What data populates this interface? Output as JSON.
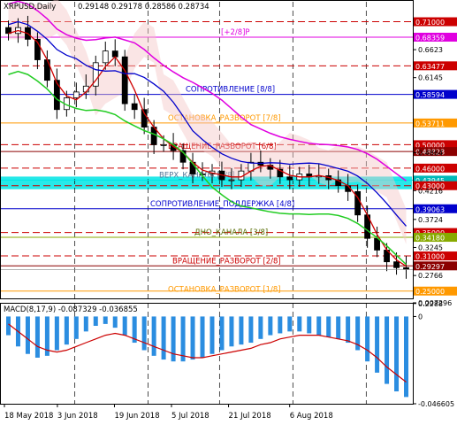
{
  "chart_data": [
    {
      "type": "candlestick",
      "title": "XRPUSD,Daily",
      "ohlc_label": "0.29148 0.29178 0.28586 0.28734",
      "ylim": [
        0.236,
        0.735
      ],
      "y_ticks": [
        0.6623,
        0.6145,
        0.4864,
        0.4216,
        0.3724,
        0.3245,
        0.2766,
        0.2288
      ],
      "x_labels": [
        "18 May 2018",
        "3 Jun 2018",
        "19 Jun 2018",
        "5 Jul 2018",
        "21 Jul 2018",
        "6 Aug 2018"
      ],
      "series": [
        {
          "values": [
            0.69,
            0.7,
            0.68,
            0.645,
            0.61,
            0.56,
            0.58,
            0.59,
            0.6,
            0.64,
            0.66,
            0.65,
            0.57,
            0.56,
            0.53,
            0.5,
            0.5,
            0.49,
            0.47,
            0.45,
            0.45,
            0.455,
            0.44,
            0.44,
            0.455,
            0.47,
            0.465,
            0.458,
            0.445,
            0.44,
            0.45,
            0.445,
            0.447,
            0.44,
            0.43,
            0.42,
            0.38,
            0.34,
            0.32,
            0.3,
            0.29,
            0.287
          ]
        }
      ],
      "levels": [
        {
          "label": "",
          "value": 0.71,
          "price": "0.71000"
        },
        {
          "label": "[+2/8]P",
          "value": 0.6836,
          "price": "0.68359"
        },
        {
          "label": "",
          "value": 0.6347,
          "price": "0.63477"
        },
        {
          "label": "",
          "value": 0.5859,
          "price": "0.58594"
        },
        {
          "label": "СОПРОТИВЛЕНИЕ [8/8]",
          "value": 0.5859,
          "price": ""
        },
        {
          "label": "ОСТАНОВКА_РАЗВОРОТ [7/8]",
          "value": 0.5371,
          "price": "0.53711"
        },
        {
          "label": "",
          "value": 0.5,
          "price": "0.50000"
        },
        {
          "label": "",
          "value": 0.4883,
          "price": "0.48828"
        },
        {
          "label": "ВРАЩЕНИЕ_РАЗВОРОТ [6/8]",
          "value": 0.4883,
          "price": ""
        },
        {
          "label": "",
          "value": 0.46,
          "price": "0.46000"
        },
        {
          "label": "",
          "value": 0.4395,
          "price": "0.43945"
        },
        {
          "label": "ВЕРХ_КАНАЛА [5/8]",
          "value": 0.4395,
          "price": ""
        },
        {
          "label": "",
          "value": 0.43,
          "price": "0.43000"
        },
        {
          "label": "",
          "value": 0.3906,
          "price": "0.39063"
        },
        {
          "label": "СОПРОТИВЛЕНИЕ_ПОДДЕРЖКА [4/8]",
          "value": 0.3906,
          "price": ""
        },
        {
          "label": "",
          "value": 0.35,
          "price": "0.35000"
        },
        {
          "label": "",
          "value": 0.3418,
          "price": "0.34180"
        },
        {
          "label": "ДНО_КАНАЛА [3/8]",
          "value": 0.3418,
          "price": ""
        },
        {
          "label": "",
          "value": 0.31,
          "price": "0.31000"
        },
        {
          "label": "",
          "value": 0.293,
          "price": "0.29297"
        },
        {
          "label": "ВРАЩЕНИЕ_РАЗВОРОТ [2/8]",
          "value": 0.293,
          "price": ""
        },
        {
          "label": "",
          "value": 0.25,
          "price": "0.25000"
        },
        {
          "label": "ОСТАНОВКА_РАЗВОРОТ [1/8]",
          "value": 0.2441,
          "price": ""
        }
      ],
      "current_price": "0.28734",
      "colors": {
        "bull": "#000000",
        "bear": "#000000",
        "ema_red": "#d00000",
        "ma_blue": "#0000cc",
        "green": "#22cc22",
        "magenta": "#e000e0",
        "cyan_zone": "#00e5e5",
        "orange": "#ff9900",
        "dark_red": "#8b0000"
      }
    },
    {
      "type": "histogram",
      "title": "MACD(8,17,9) -0.087329 -0.036855",
      "ylim": [
        -0.046605,
        0.007296
      ],
      "y_ticks": [
        0.007296,
        0.0,
        -0.046605
      ],
      "x_labels": [
        "18 May 2018",
        "3 Jun 2018",
        "19 Jun 2018",
        "5 Jul 2018",
        "21 Jul 2018",
        "6 Aug 2018"
      ],
      "series": [
        {
          "values": [
            -0.01,
            -0.016,
            -0.02,
            -0.022,
            -0.021,
            -0.018,
            -0.015,
            -0.012,
            -0.008,
            -0.005,
            -0.004,
            -0.006,
            -0.01,
            -0.014,
            -0.018,
            -0.021,
            -0.023,
            -0.024,
            -0.024,
            -0.023,
            -0.022,
            -0.02,
            -0.018,
            -0.016,
            -0.015,
            -0.014,
            -0.012,
            -0.01,
            -0.009,
            -0.008,
            -0.008,
            -0.009,
            -0.01,
            -0.011,
            -0.012,
            -0.014,
            -0.018,
            -0.024,
            -0.03,
            -0.036,
            -0.04,
            -0.043
          ]
        },
        {
          "values": [
            -0.004,
            -0.008,
            -0.012,
            -0.016,
            -0.018,
            -0.019,
            -0.018,
            -0.016,
            -0.014,
            -0.012,
            -0.01,
            -0.009,
            -0.01,
            -0.012,
            -0.014,
            -0.016,
            -0.018,
            -0.02,
            -0.021,
            -0.022,
            -0.022,
            -0.021,
            -0.02,
            -0.019,
            -0.018,
            -0.017,
            -0.015,
            -0.014,
            -0.012,
            -0.011,
            -0.01,
            -0.01,
            -0.01,
            -0.011,
            -0.012,
            -0.013,
            -0.015,
            -0.018,
            -0.022,
            -0.027,
            -0.031,
            -0.035
          ]
        }
      ]
    }
  ]
}
